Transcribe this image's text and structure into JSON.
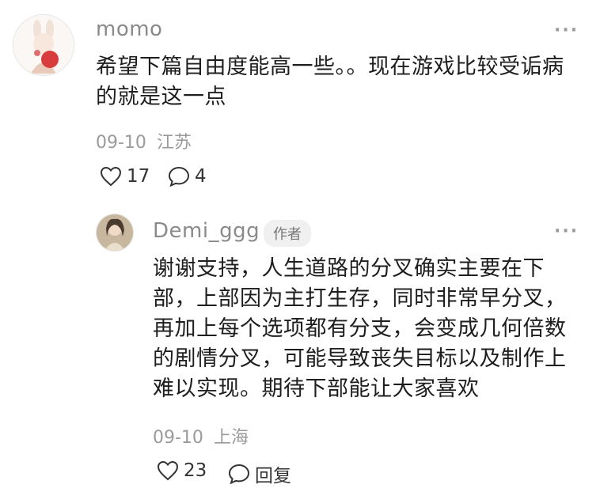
{
  "comment": {
    "author": "momo",
    "text_lines": [
      "希望下篇自由度能高一些。。现在游戏比较受诟病",
      "的就是这一点"
    ],
    "date": "09-10",
    "location": "江苏",
    "like_count": "17",
    "reply_count": "4",
    "more_label": "···"
  },
  "reply": {
    "author": "Demi_ggg",
    "badge": "作者",
    "text_lines": [
      "谢谢支持，人生道路的分叉确实主要在下",
      "部，上部因为主打生存，同时非常早分叉，",
      "再加上每个选项都有分支，会变成几何倍数",
      "的剧情分叉，可能导致丧失目标以及制作上",
      "难以实现。期待下部能让大家喜欢"
    ],
    "date": "09-10",
    "location": "上海",
    "like_count": "23",
    "reply_label": "回复",
    "more_label": "···"
  },
  "colors": {
    "text": "#1e1e1e",
    "muted": "#9a9a9a",
    "badge_bg": "#f0f0f0"
  },
  "icons": {
    "like": "heart-outline-icon",
    "comment": "speech-bubble-icon",
    "more": "ellipsis-icon"
  }
}
